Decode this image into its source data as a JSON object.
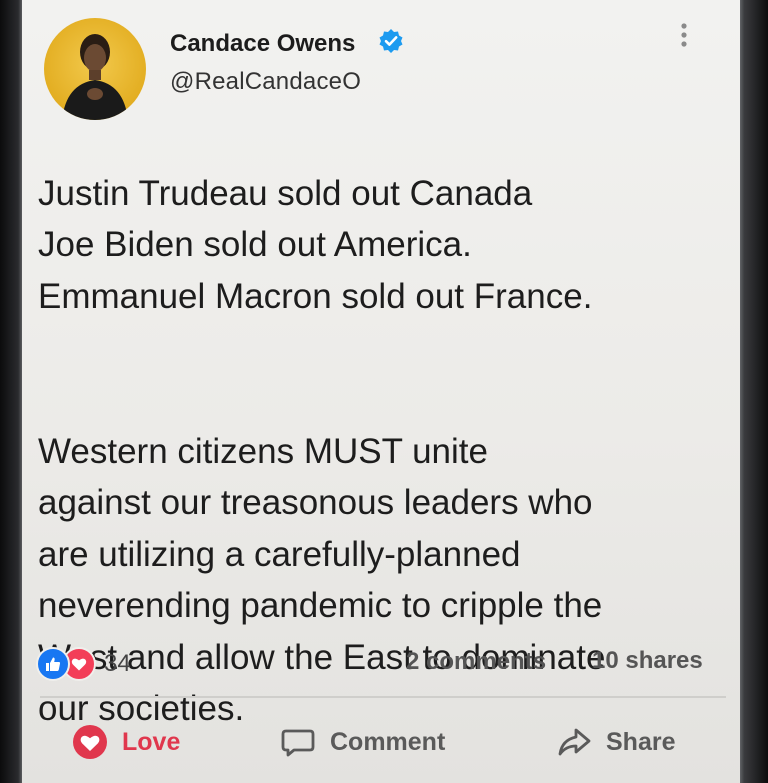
{
  "post": {
    "author_name": "Candace Owens",
    "author_handle": "@RealCandaceO",
    "body_lines_1": "Justin Trudeau sold out Canada\nJoe Biden sold out America.\nEmmanuel Macron sold out France.",
    "body_lines_2": "Western citizens MUST unite\nagainst our treasonous leaders who\nare utilizing a carefully-planned\nneverending pandemic to cripple the\nWest and allow the East to dominate\nour societies."
  },
  "stats": {
    "reaction_count": "34",
    "comments": "2 comments",
    "shares": "10 shares"
  },
  "actions": {
    "love_label": "Love",
    "comment_label": "Comment",
    "share_label": "Share"
  },
  "icons": {
    "verified": "verified-badge-icon",
    "more": "more-options-icon",
    "like": "like-icon",
    "love": "love-icon",
    "comment": "comment-icon",
    "share": "share-icon"
  },
  "colors": {
    "verified_blue": "#1d9bf0",
    "like_blue": "#1877f2",
    "love_red": "#f33e58",
    "love_active": "#e0374d"
  }
}
